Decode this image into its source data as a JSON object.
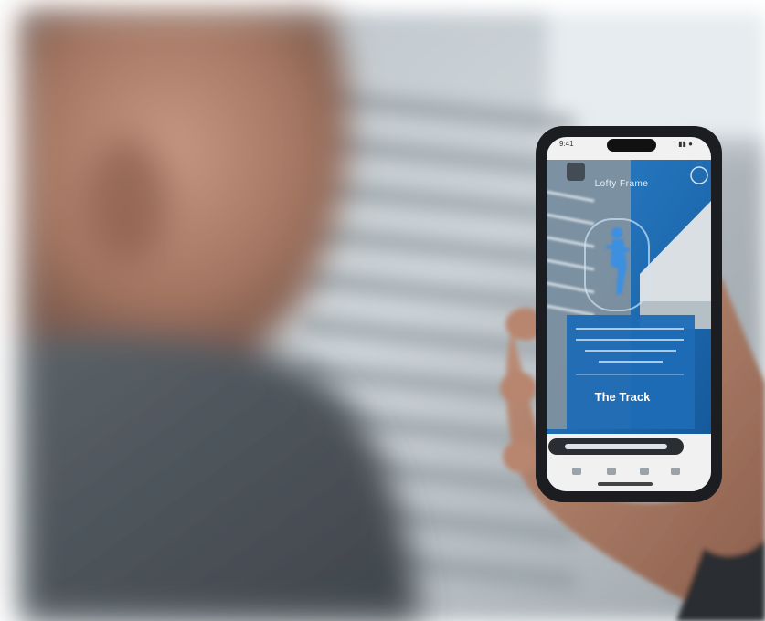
{
  "photo": {
    "description_scene": "person holding smartphone with AR fitness app near building",
    "colors": {
      "sky": "#e8eef1",
      "wall_light": "#c9d1d6",
      "slats": "#aab4ba",
      "jacket": "#4c5359",
      "skin": "#b98a72",
      "phone_frame": "#1b1d20",
      "screen_blue": "#1f6fb8",
      "screen_top": "#f1f1f1",
      "runner": "#3e8fe0"
    }
  },
  "screen": {
    "status_time": "9:41",
    "status_indicators": "▮▮ ●",
    "header": "Lofty Frame",
    "feature_label": "The Track"
  }
}
